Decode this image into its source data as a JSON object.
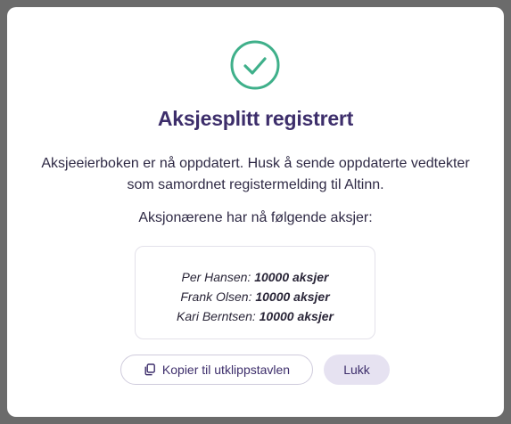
{
  "modal": {
    "icon": "check-circle-icon",
    "title": "Aksjesplitt registrert",
    "description_line1": "Aksjeeierboken er nå oppdatert. Husk å sende oppdaterte vedtekter",
    "description_line2": "som samordnet registermelding til Altinn.",
    "holdings_heading": "Aksjonærene har nå følgende aksjer:",
    "holders": [
      {
        "name": "Per Hansen:",
        "amount": "10000 aksjer"
      },
      {
        "name": "Frank Olsen:",
        "amount": "10000 aksjer"
      },
      {
        "name": "Kari Berntsen:",
        "amount": "10000 aksjer"
      }
    ],
    "copy_button": {
      "label": "Kopier til utklippstavlen",
      "icon": "copy-icon"
    },
    "close_button": {
      "label": "Lukk"
    }
  },
  "colors": {
    "success": "#3fb08a",
    "title": "#3d2e6b",
    "close_button_bg": "#e6e2f1",
    "backdrop": "#6b6b6b"
  }
}
